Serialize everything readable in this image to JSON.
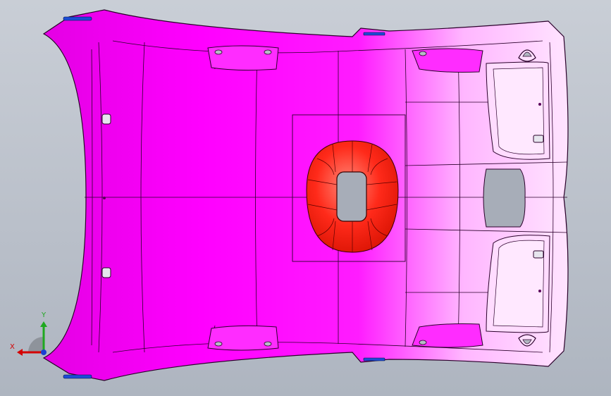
{
  "viewport": {
    "background_top": "#c9ced6",
    "background_bottom": "#aeb5c0"
  },
  "model": {
    "part_color": "#ff00ff",
    "part_highlight": "#ffd6ff",
    "edge_color": "#1a001a",
    "selected_feature_color": "#ff2a1a",
    "hole_color": "#a7adb8",
    "clip_color": "#1d4bd6"
  },
  "triad": {
    "x_label": "X",
    "y_label": "Y",
    "x_color": "#d40000",
    "y_color": "#1fa81f",
    "z_color": "#1b3fd1"
  }
}
